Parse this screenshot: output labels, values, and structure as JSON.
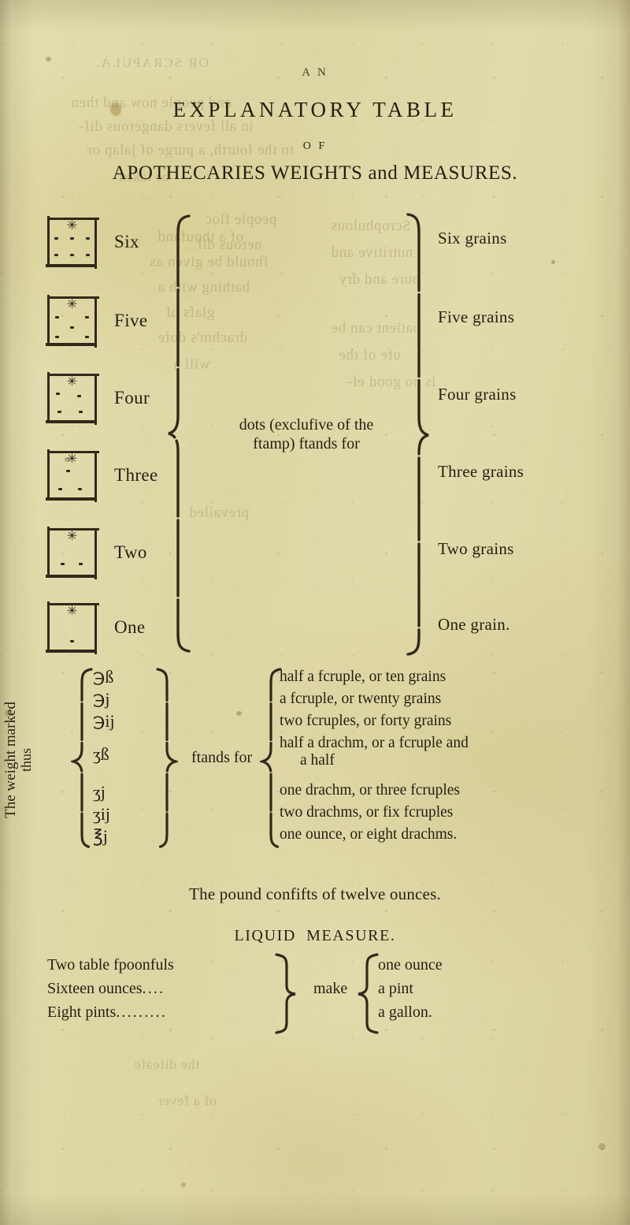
{
  "page": {
    "background_color": "#ded9a8",
    "ink_color": "#241f12",
    "running_head": "A N",
    "title": "EXPLANATORY TABLE",
    "title_of": "O F",
    "subtitle_parts": {
      "apothecaries": "APOTHECARIES",
      "weights": "WEIGHTS",
      "and": "and",
      "measures": "MEASURES."
    },
    "subtitle_full": "Apothecaries Weights and Measures."
  },
  "weights_table": {
    "center_note_line1": "dots (exclufive of the",
    "center_note_line2": "ftamp) ftands for",
    "rows": [
      {
        "name": "six",
        "label": "Six",
        "dots": 6,
        "value": "Six grains"
      },
      {
        "name": "five",
        "label": "Five",
        "dots": 5,
        "value": "Five grains"
      },
      {
        "name": "four",
        "label": "Four",
        "dots": 4,
        "value": "Four grains"
      },
      {
        "name": "three",
        "label": "Three",
        "dots": 3,
        "value": "Three grains"
      },
      {
        "name": "two",
        "label": "Two",
        "dots": 2,
        "value": "Two grains"
      },
      {
        "name": "one",
        "label": "One",
        "dots": 1,
        "value": "One grain."
      }
    ],
    "stamp_glyph": "✳"
  },
  "symbols_table": {
    "vertical_label_line1": "The weight marked",
    "vertical_label_line2": "thus",
    "stands_for": "ftands for",
    "rows": [
      {
        "symbol": "℈ß",
        "meaning": "half a fcruple, or ten grains"
      },
      {
        "symbol": "℈j",
        "meaning": "a fcruple, or twenty grains"
      },
      {
        "symbol": "℈ij",
        "meaning": "two fcruples, or forty grains"
      },
      {
        "symbol": "ʒß",
        "meaning": "half a drachm,  or a fcruple and",
        "meaning_cont": "a half"
      },
      {
        "symbol": "ʒj",
        "meaning": "one drachm, or three fcruples"
      },
      {
        "symbol": "ʒij",
        "meaning": "two drachms, or fix fcruples"
      },
      {
        "symbol": "℥j",
        "meaning": "one ounce, or eight drachms."
      }
    ]
  },
  "pound_note": "The pound confifts of twelve ounces.",
  "liquid_measure": {
    "heading_parts": {
      "liquid": "LIQUID",
      "measure": "MEASURE."
    },
    "heading": "Liquid Measure.",
    "make_label": "make",
    "rows": [
      {
        "quantity": "Two table fpoonfuls",
        "leader": "",
        "result": "one ounce"
      },
      {
        "quantity": "Sixteen  ounces",
        "leader": "....",
        "result": "a pint"
      },
      {
        "quantity": "Eight pints",
        "leader": ".........",
        "result": "a gallon."
      }
    ]
  }
}
